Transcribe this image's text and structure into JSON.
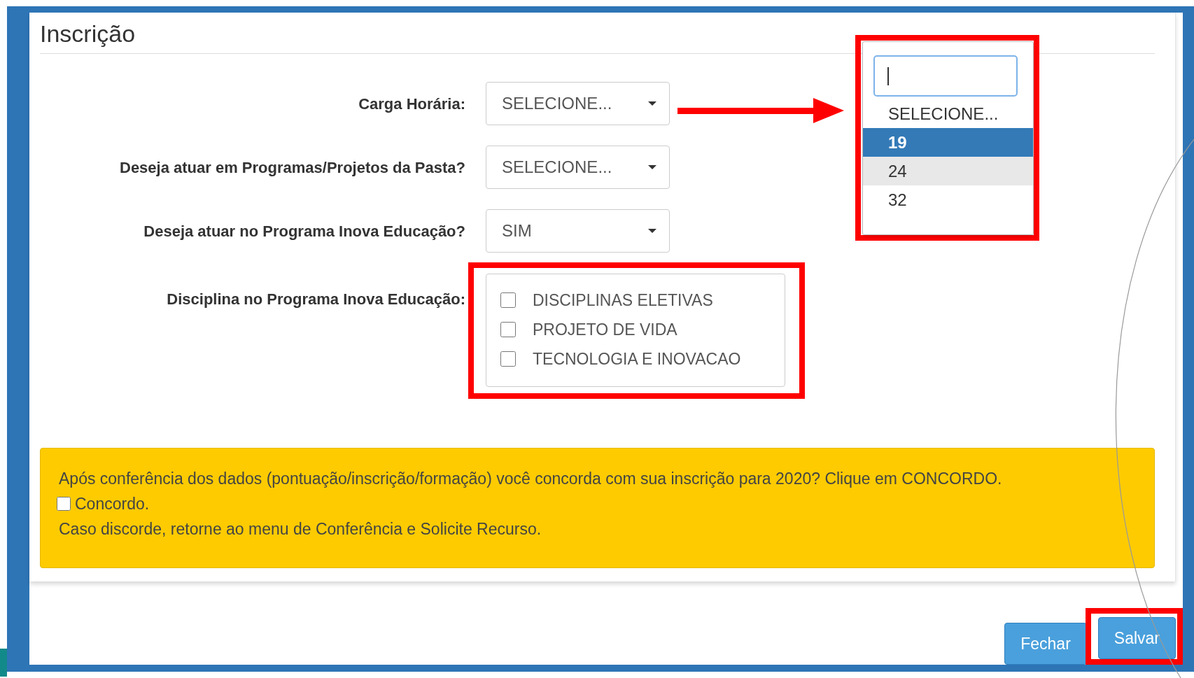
{
  "title": "Inscrição",
  "fields": [
    {
      "kind": "select",
      "label": "Carga Horária:",
      "value": "SELECIONE...",
      "arrow": true
    },
    {
      "kind": "select",
      "label": "Deseja atuar em Programas/Projetos da Pasta?",
      "value": "SELECIONE...",
      "arrow": false
    },
    {
      "kind": "select",
      "label": "Deseja atuar no Programa Inova Educação?",
      "value": "SIM",
      "arrow": false
    },
    {
      "kind": "checkboxes",
      "label": "Disciplina no Programa Inova Educação:",
      "annotated": true,
      "options": [
        {
          "label": "DISCIPLINAS ELETIVAS",
          "checked": false
        },
        {
          "label": "PROJETO DE VIDA",
          "checked": false
        },
        {
          "label": "TECNOLOGIA E INOVACAO",
          "checked": false
        }
      ]
    }
  ],
  "dropdown": {
    "open": true,
    "annotated": true,
    "options": [
      {
        "label": "SELECIONE...",
        "selected": false,
        "hovered": false
      },
      {
        "label": "19",
        "selected": true,
        "hovered": false
      },
      {
        "label": "24",
        "selected": false,
        "hovered": true
      },
      {
        "label": "32",
        "selected": false,
        "hovered": false
      }
    ]
  },
  "notice": {
    "lines": [
      {
        "kind": "text",
        "text": "Após conferência dos dados (pontuação/inscrição/formação) você concorda com sua inscrição para 2020? Clique em CONCORDO."
      },
      {
        "kind": "checkbox",
        "label": "Concordo.",
        "checked": false
      },
      {
        "kind": "text",
        "text": "Caso discorde, retorne ao menu de Conferência e Solicite Recurso."
      }
    ]
  },
  "buttons": [
    {
      "label": "Fechar",
      "annotated": false
    },
    {
      "label": "Salvar",
      "annotated": true
    }
  ]
}
